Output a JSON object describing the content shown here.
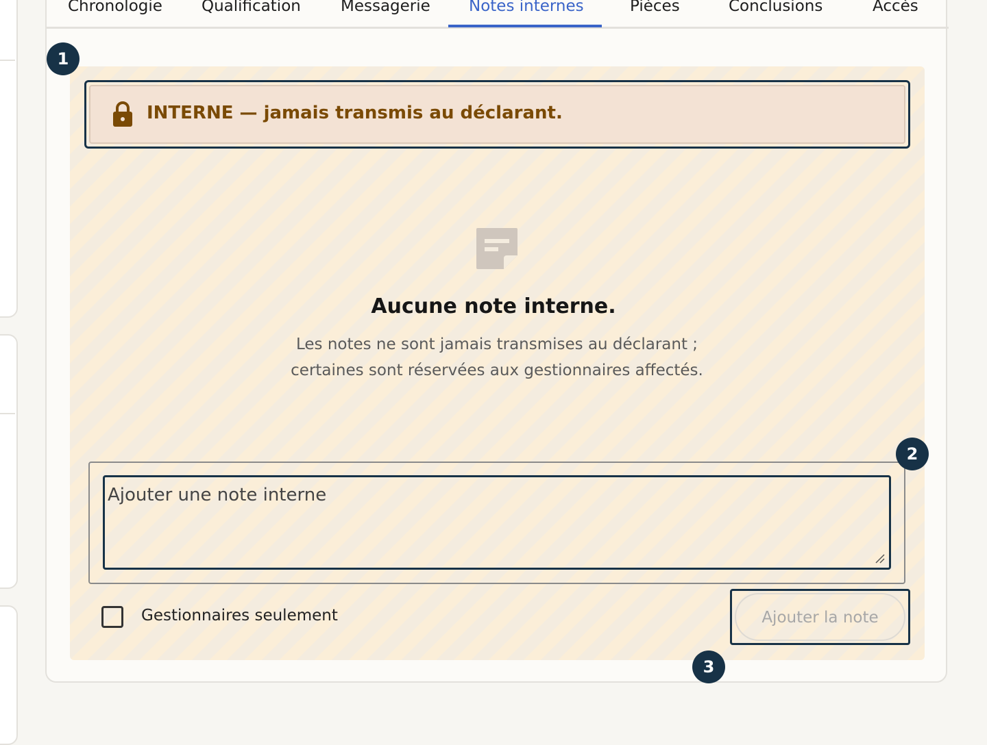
{
  "tabs": [
    {
      "label": "Chronologie"
    },
    {
      "label": "Qualification"
    },
    {
      "label": "Messagerie"
    },
    {
      "label": "Notes internes",
      "active": true
    },
    {
      "label": "Pièces"
    },
    {
      "label": "Conclusions"
    },
    {
      "label": "Accès"
    }
  ],
  "banner": {
    "text": "INTERNE — jamais transmis au déclarant.",
    "icon": "lock-icon"
  },
  "empty_state": {
    "icon": "note-icon",
    "title": "Aucune note interne.",
    "line1": "Les notes ne sont jamais transmises au déclarant ;",
    "line2": "certaines sont réservées aux gestionnaires affectés."
  },
  "composer": {
    "placeholder": "Ajouter une note interne",
    "checkbox_label": "Gestionnaires seulement",
    "checkbox_checked": false,
    "submit_label": "Ajouter la note",
    "submit_disabled": true
  },
  "badges": [
    "1",
    "2",
    "3"
  ],
  "colors": {
    "accent": "#3a64c8",
    "focus_ring": "#173247",
    "banner_text": "#7a4a05",
    "stripe_a": "#fbeed8",
    "stripe_b": "#f4ecdf"
  }
}
